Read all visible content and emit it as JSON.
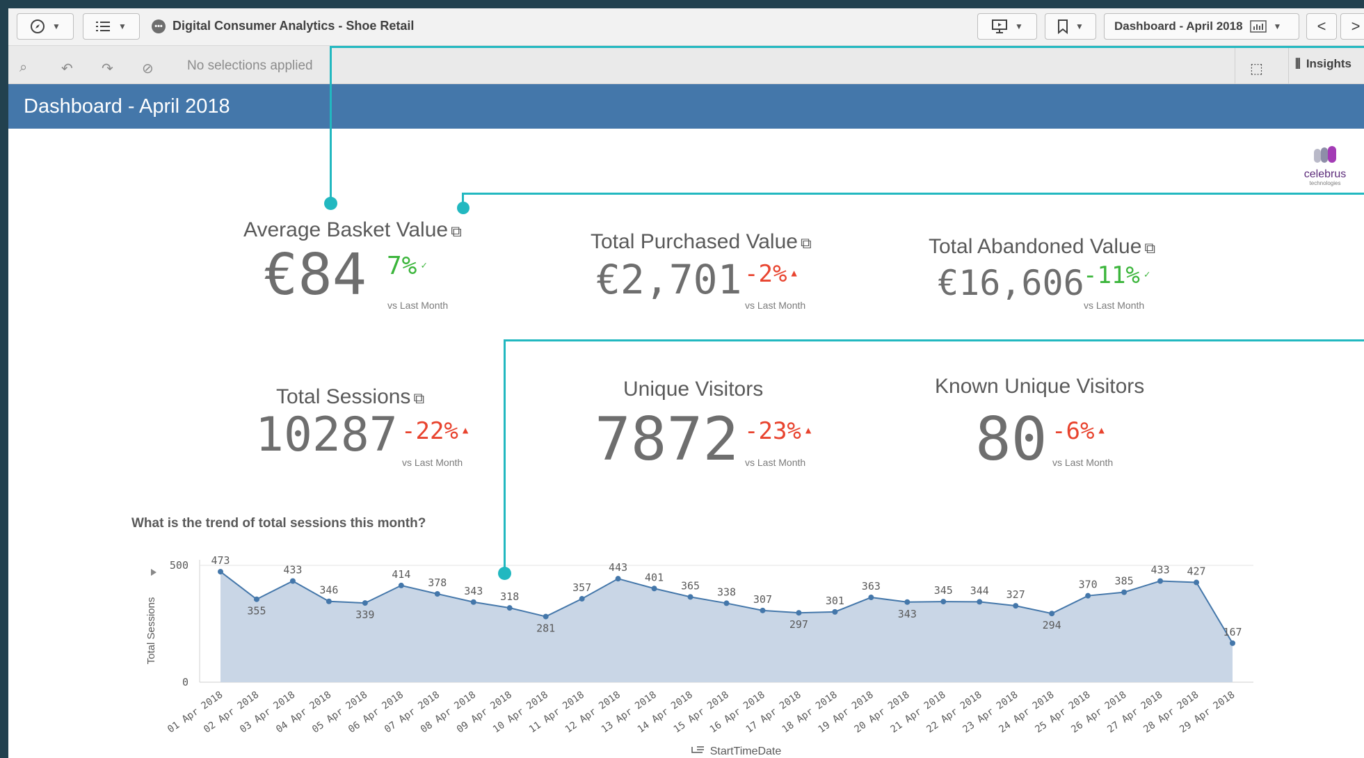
{
  "toolbar": {
    "app_title": "Digital Consumer Analytics - Shoe Retail",
    "sheet_selector": "Dashboard - April 2018",
    "icons": [
      "compass-icon",
      "list-icon",
      "present-icon",
      "bookmark-icon",
      "chevron-left-icon",
      "chevron-right-icon"
    ]
  },
  "selection_bar": {
    "status": "No selections applied",
    "insights_label": "Insights"
  },
  "sheet": {
    "title": "Dashboard - April 2018",
    "logo_text": "celebrus",
    "logo_subtext": "technologies"
  },
  "kpis": {
    "avg_basket": {
      "title": "Average Basket Value",
      "value": "€84",
      "delta": "7%",
      "arrow": "✓",
      "vs": "vs Last Month"
    },
    "purchased": {
      "title": "Total Purchased Value",
      "value": "€2,701",
      "delta": "-2%",
      "arrow": "▲",
      "vs": "vs Last Month"
    },
    "abandoned": {
      "title": "Total Abandoned Value",
      "value": "€16,606",
      "delta": "-11%",
      "arrow": "✓",
      "vs": "vs Last Month"
    },
    "sessions": {
      "title": "Total Sessions",
      "value": "10287",
      "delta": "-22%",
      "arrow": "▲",
      "vs": "vs Last Month"
    },
    "unique": {
      "title": "Unique Visitors",
      "value": "7872",
      "delta": "-23%",
      "arrow": "▲",
      "vs": "vs Last Month"
    },
    "known": {
      "title": "Known Unique Visitors",
      "value": "80",
      "delta": "-6%",
      "arrow": "▲",
      "vs": "vs Last Month"
    }
  },
  "chart_question": "What is the trend of total sessions this month?",
  "colors": {
    "accent": "#22b8c0",
    "header": "#4477aa",
    "area": "#c9d6e6",
    "line": "#4477aa",
    "up": "#3bb53b",
    "down": "#e8432e"
  },
  "chart_data": {
    "type": "area",
    "x": [
      "01 Apr 2018",
      "02 Apr 2018",
      "03 Apr 2018",
      "04 Apr 2018",
      "05 Apr 2018",
      "06 Apr 2018",
      "07 Apr 2018",
      "08 Apr 2018",
      "09 Apr 2018",
      "10 Apr 2018",
      "11 Apr 2018",
      "12 Apr 2018",
      "13 Apr 2018",
      "14 Apr 2018",
      "15 Apr 2018",
      "16 Apr 2018",
      "17 Apr 2018",
      "18 Apr 2018",
      "19 Apr 2018",
      "20 Apr 2018",
      "21 Apr 2018",
      "22 Apr 2018",
      "23 Apr 2018",
      "24 Apr 2018",
      "25 Apr 2018",
      "26 Apr 2018",
      "27 Apr 2018",
      "28 Apr 2018",
      "29 Apr 2018"
    ],
    "values": [
      473,
      355,
      433,
      346,
      339,
      414,
      378,
      343,
      318,
      281,
      357,
      443,
      401,
      365,
      338,
      307,
      297,
      301,
      363,
      343,
      345,
      344,
      327,
      294,
      370,
      385,
      433,
      427,
      167
    ],
    "xlabel": "StartTimeDate",
    "ylabel": "Total Sessions",
    "ylim": [
      0,
      500
    ],
    "yticks": [
      0,
      500
    ],
    "grid": true
  }
}
